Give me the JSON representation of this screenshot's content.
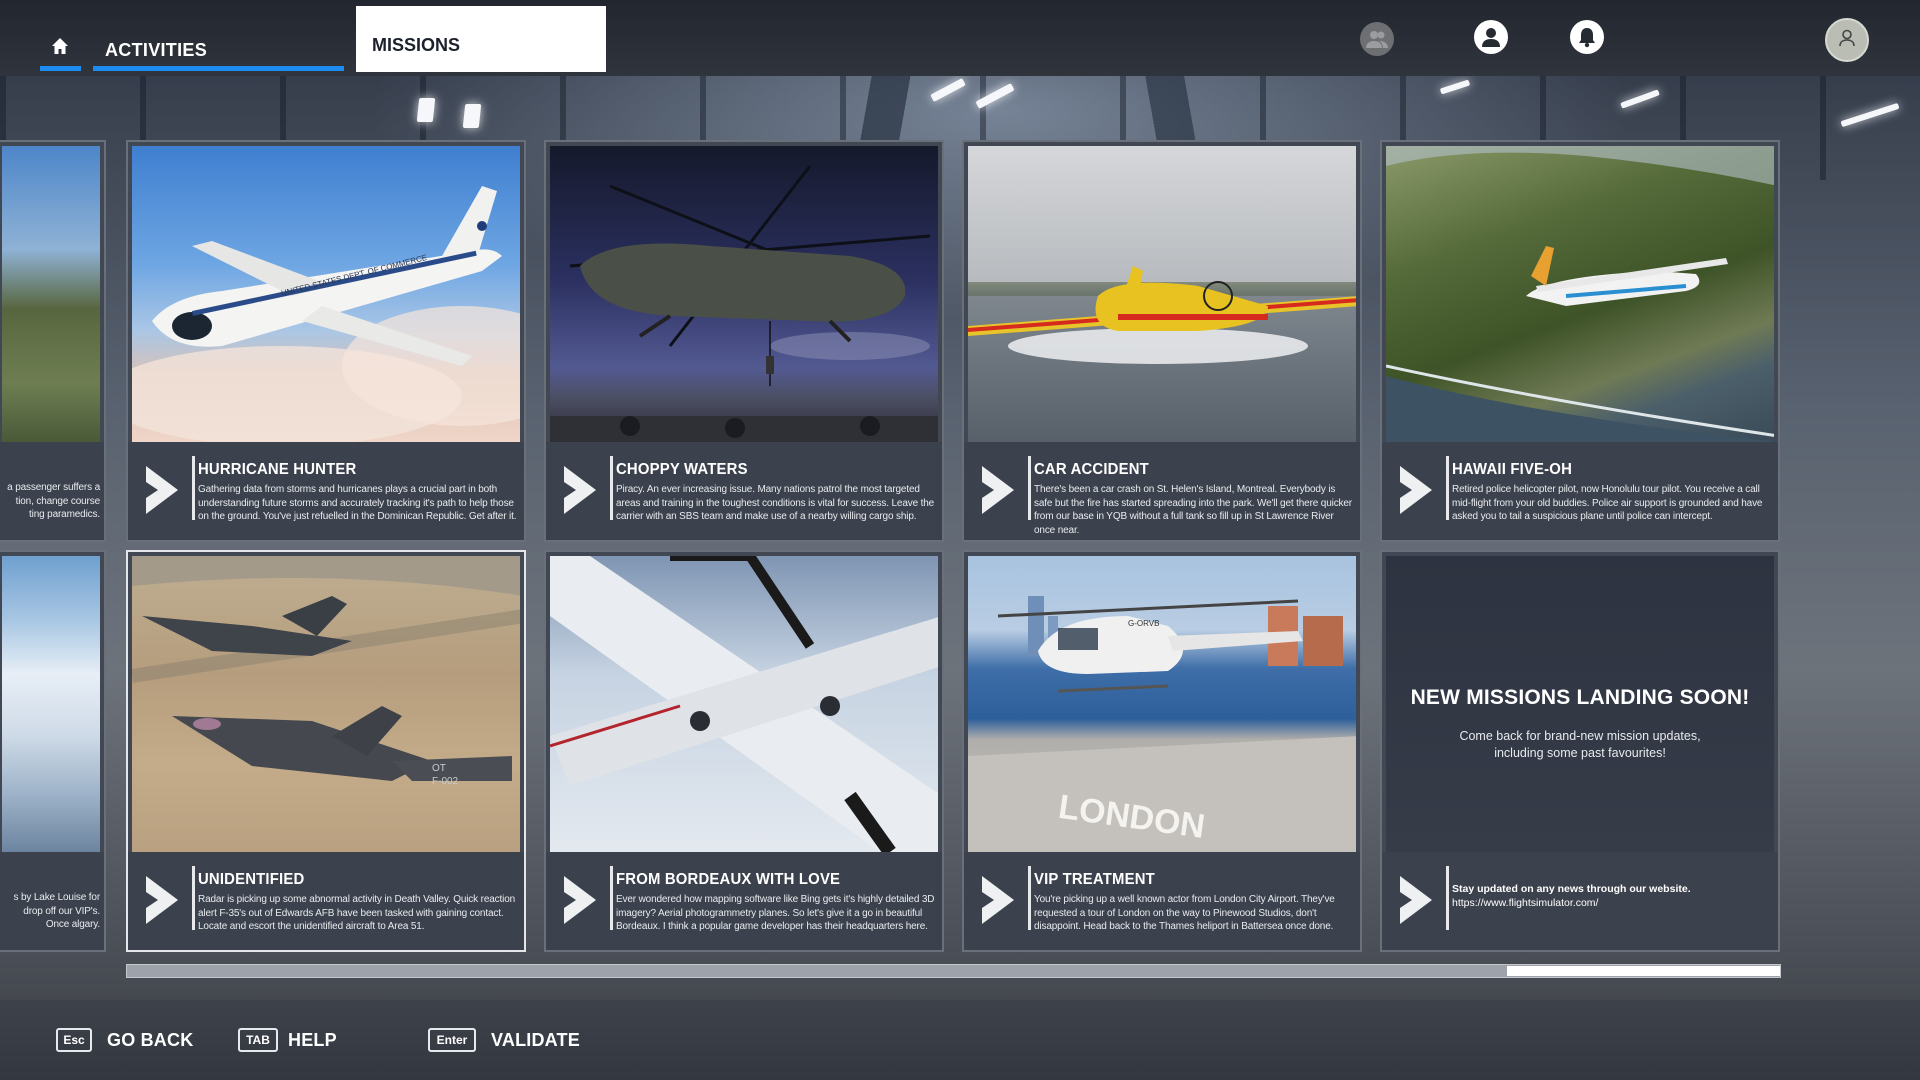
{
  "topbar": {
    "tab_activities": "ACTIVITIES",
    "tab_missions": "MISSIONS",
    "icons": [
      "home-icon",
      "friends-icon",
      "profile-icon",
      "notification-icon",
      "user-avatar-icon"
    ]
  },
  "cards_row1": [
    {
      "partial": true,
      "desc": "a passenger suffers a tion, change course ting paramedics."
    },
    {
      "title": "HURRICANE HUNTER",
      "desc": "Gathering data from storms and hurricanes plays a crucial part in both understanding future storms and accurately tracking it's path to help those on the ground. You've just refuelled in the Dominican Republic. Get after it."
    },
    {
      "title": "CHOPPY WATERS",
      "desc": "Piracy. An ever increasing issue. Many nations patrol the most targeted areas and training in the toughest conditions is vital for success. Leave the carrier with an SBS team and make use of a nearby willing cargo ship."
    },
    {
      "title": "CAR ACCIDENT",
      "desc": "There's been a car crash on St. Helen's Island, Montreal. Everybody is safe but the fire has started spreading into the park. We'll get there quicker from our base in YQB without a full tank so fill up in St Lawrence River once near."
    },
    {
      "title": "HAWAII FIVE-OH",
      "desc": "Retired police helicopter pilot, now Honolulu tour pilot. You receive a call mid-flight from your old buddies. Police air support is grounded and have asked you to tail a suspicious plane until police can intercept."
    }
  ],
  "cards_row2": [
    {
      "partial": true,
      "desc": "s by Lake Louise for drop off our VIP's. Once algary."
    },
    {
      "title": "UNIDENTIFIED",
      "desc": "Radar is picking up some abnormal activity in Death Valley. Quick reaction alert F-35's out of Edwards AFB have been tasked with gaining contact. Locate and escort the unidentified aircraft to Area 51."
    },
    {
      "title": "FROM BORDEAUX WITH LOVE",
      "desc": "Ever wondered how mapping software like Bing gets it's highly detailed 3D imagery? Aerial photogrammetry planes. So let's give it a go in beautiful Bordeaux. I think a popular game developer has their headquarters here."
    },
    {
      "title": "VIP TREATMENT",
      "desc": "You're picking up a well known actor from London City Airport. They've requested a tour of London on the way to Pinewood Studios, don't disappoint. Head back to the Thames heliport in Battersea once done."
    }
  ],
  "coming_soon": {
    "title": "NEW MISSIONS LANDING SOON!",
    "text": "Come back for brand-new mission updates, including some past favourites!",
    "info_bold": "Stay updated on any news through our website.",
    "info_url": "https://www.flightsimulator.com/"
  },
  "image_labels": {
    "plane_text": "UNITED STATES DEPT. OF COMMERCE",
    "heli_text": "G-ORVB",
    "helipad_text": "LONDON",
    "jet_text_1": "OT",
    "jet_text_2": "F-002"
  },
  "scroll": {
    "position": 1.0
  },
  "bottombar": {
    "keys": [
      {
        "key": "Esc",
        "label": "GO BACK"
      },
      {
        "key": "TAB",
        "label": "HELP"
      },
      {
        "key": "Enter",
        "label": "VALIDATE"
      }
    ]
  },
  "colors": {
    "accent": "#1c8cf0"
  }
}
